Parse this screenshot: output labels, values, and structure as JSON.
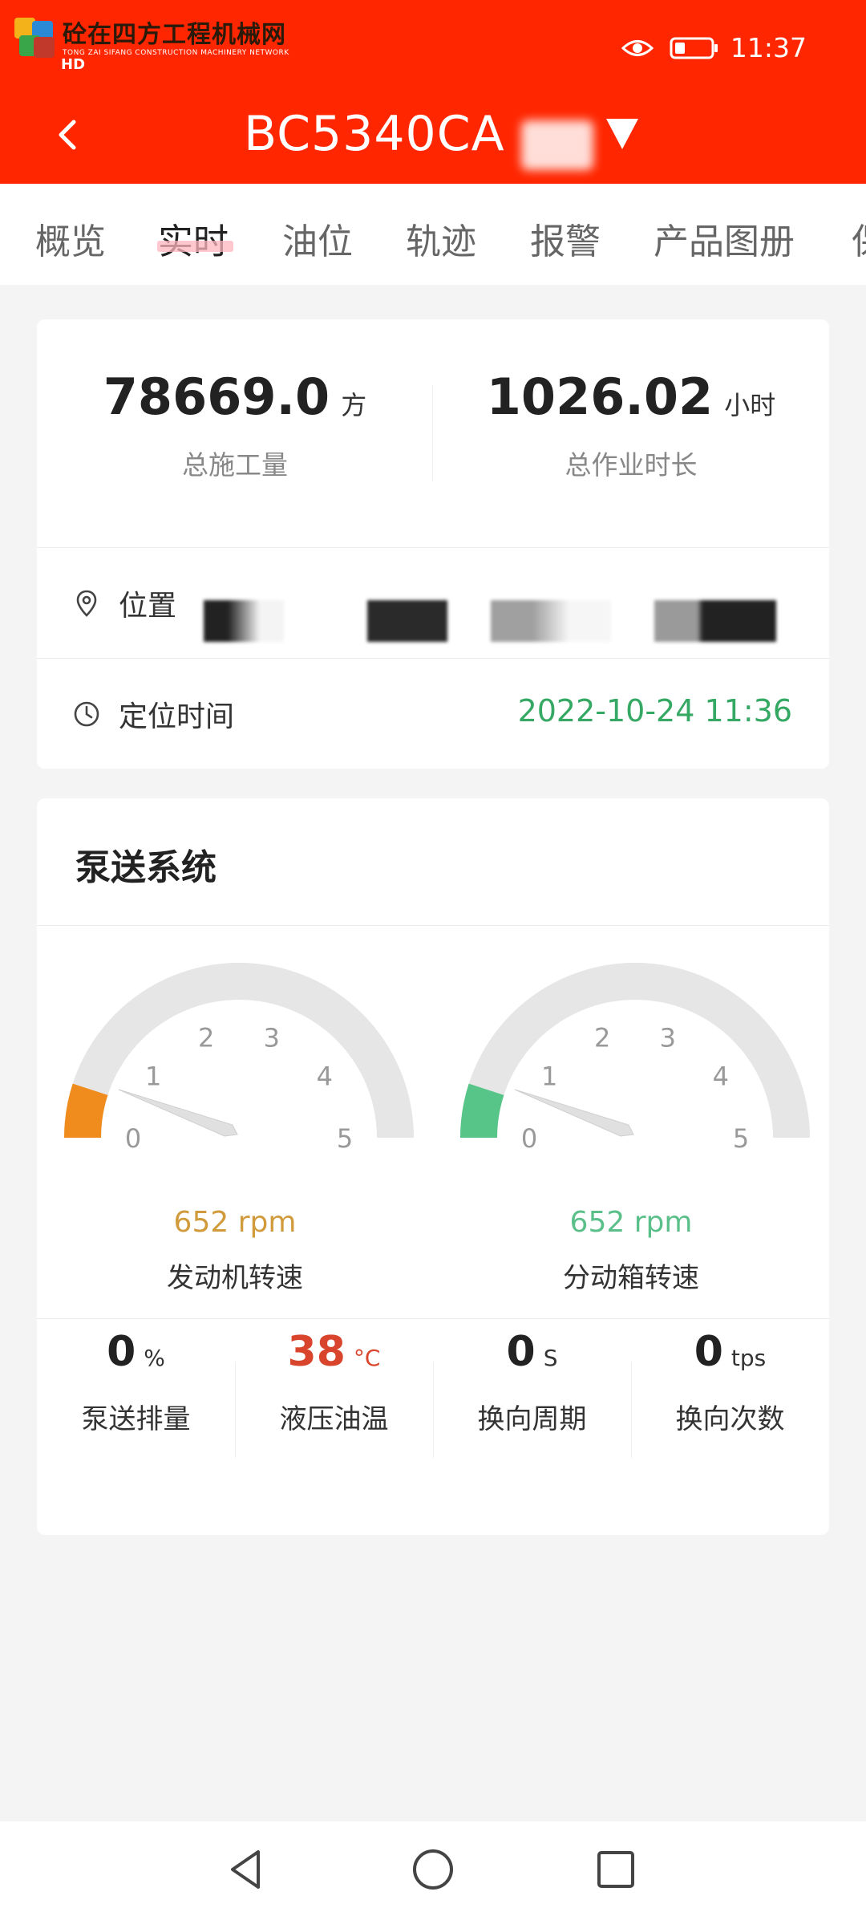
{
  "status_bar": {
    "time": "11:37",
    "network_badge": "HD",
    "watermark_cn": "砼在四方工程机械网",
    "watermark_en": "TONG ZAI SIFANG CONSTRUCTION MACHINERY NETWORK"
  },
  "header": {
    "title": "BC5340CA",
    "color": "#ff2600"
  },
  "tabs": [
    {
      "label": "概览",
      "active": false
    },
    {
      "label": "实时",
      "active": true
    },
    {
      "label": "油位",
      "active": false
    },
    {
      "label": "轨迹",
      "active": false
    },
    {
      "label": "报警",
      "active": false
    },
    {
      "label": "产品图册",
      "active": false
    },
    {
      "label": "保",
      "active": false
    }
  ],
  "summary": {
    "total_volume": {
      "value": "78669.0",
      "unit": "方",
      "label": "总施工量"
    },
    "total_hours": {
      "value": "1026.02",
      "unit": "小时",
      "label": "总作业时长"
    },
    "location": {
      "label": "位置"
    },
    "location_time": {
      "label": "定位时间",
      "value": "2022-10-24 11:36"
    }
  },
  "pump_system": {
    "title": "泵送系统",
    "gauges": [
      {
        "value_text": "652 rpm",
        "label": "发动机转速",
        "fill_fraction": 0.1,
        "color": "#f08c1e",
        "needle_value": 0.5,
        "ticks": [
          "0",
          "1",
          "2",
          "3",
          "4",
          "5"
        ]
      },
      {
        "value_text": "652 rpm",
        "label": "分动箱转速",
        "fill_fraction": 0.1,
        "color": "#57c587",
        "needle_value": 0.5,
        "ticks": [
          "0",
          "1",
          "2",
          "3",
          "4",
          "5"
        ]
      }
    ],
    "metrics": [
      {
        "value": "0",
        "unit": "%",
        "label": "泵送排量",
        "highlight": false
      },
      {
        "value": "38",
        "unit": "°C",
        "label": "液压油温",
        "highlight": true
      },
      {
        "value": "0",
        "unit": "S",
        "label": "换向周期",
        "highlight": false
      },
      {
        "value": "0",
        "unit": "tps",
        "label": "换向次数",
        "highlight": false
      }
    ]
  },
  "colors": {
    "accent_red": "#ff2600",
    "green_text": "#35a864",
    "orange_text": "#d19a3a",
    "gauge_green_text": "#5bbf8a",
    "warn_red": "#d9452c"
  }
}
